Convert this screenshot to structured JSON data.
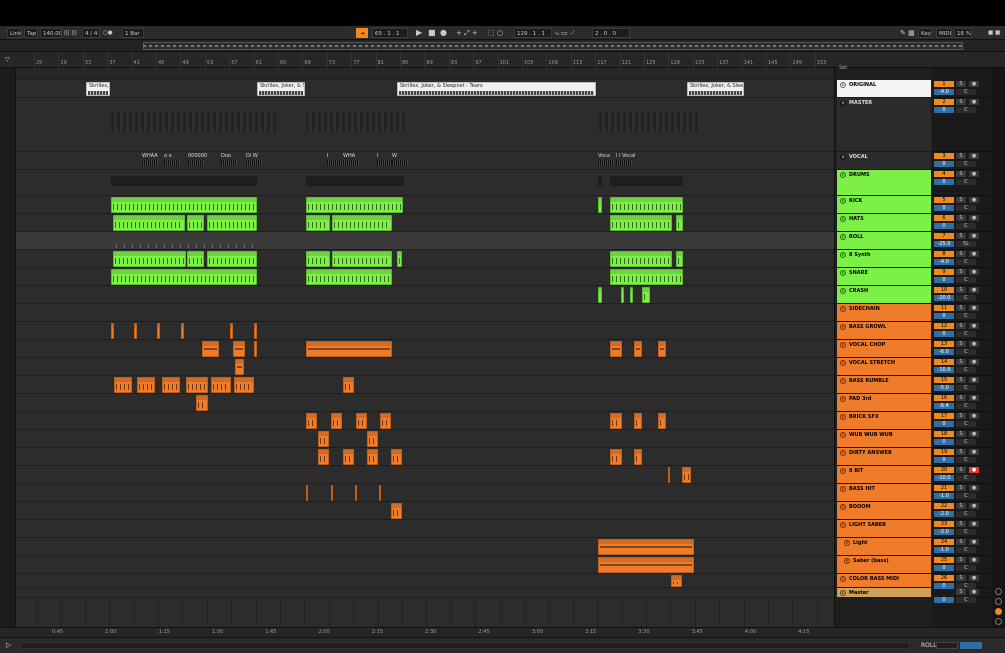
{
  "transport": {
    "link": "Link",
    "tap": "Tap",
    "tempo": "140.00",
    "sig": "4 / 4",
    "quantize": "1 Bar",
    "position": "65 .  1 .  1",
    "loop_start": "129 .  1 .  1",
    "loop_length": "2 .  0 .  0",
    "key": "Key",
    "midi": "MIDI",
    "cpu": "16 %",
    "set": "Set"
  },
  "bar_numbers": [
    "25",
    "29",
    "33",
    "37",
    "41",
    "45",
    "49",
    "53",
    "57",
    "61",
    "65",
    "69",
    "73",
    "77",
    "81",
    "85",
    "89",
    "93",
    "97",
    "101",
    "105",
    "109",
    "113",
    "117",
    "121",
    "125",
    "129",
    "133",
    "137",
    "141",
    "145",
    "149",
    "153"
  ],
  "time_markers": [
    "0:45",
    "1:00",
    "1:15",
    "1:30",
    "1:45",
    "2:00",
    "2:15",
    "2:30",
    "2:45",
    "3:00",
    "3:15",
    "3:30",
    "3:45",
    "4:00",
    "4:15"
  ],
  "reference_clips": [
    "Skrillex, J",
    "Skrillex, Joker, & Sle",
    "Skrillex, Joker, & Sleepnet - Tears",
    "Skrillex, Joker, & Sleep"
  ],
  "vocal_labels": [
    "WHAA",
    "o o",
    "000000",
    "Doo",
    "Di W",
    "I",
    "WHA",
    "I",
    "W",
    "Voca",
    "I I Vocal"
  ],
  "tracks": [
    {
      "name": "ORIGINAL",
      "num": "1",
      "vol": "-4.0",
      "pan": "C",
      "color": "white"
    },
    {
      "name": "MASTER",
      "num": "2",
      "vol": "0",
      "pan": "C",
      "color": "dark"
    },
    {
      "name": "VOCAL",
      "num": "3",
      "vol": "0",
      "pan": "C",
      "color": "dark"
    },
    {
      "name": "DRUMS",
      "num": "4",
      "vol": "0",
      "pan": "C",
      "color": "green"
    },
    {
      "name": "KICK",
      "num": "5",
      "vol": "0",
      "pan": "C",
      "color": "green"
    },
    {
      "name": "HATS",
      "num": "6",
      "vol": "0",
      "pan": "C",
      "color": "green"
    },
    {
      "name": "ROLL",
      "num": "7",
      "vol": "-25.0",
      "pan": "5L",
      "color": "green"
    },
    {
      "name": "8 Synth",
      "num": "8",
      "vol": "-4.0",
      "pan": "C",
      "color": "green"
    },
    {
      "name": "SNARE",
      "num": "9",
      "vol": "0",
      "pan": "C",
      "color": "green"
    },
    {
      "name": "CRASH",
      "num": "10",
      "vol": "-20.0",
      "pan": "C",
      "color": "green"
    },
    {
      "name": "SIDECHAIN",
      "num": "11",
      "vol": "0",
      "pan": "C",
      "color": "orange"
    },
    {
      "name": "BASS GROWL",
      "num": "12",
      "vol": "0",
      "pan": "C",
      "color": "orange"
    },
    {
      "name": "VOCAL CHOP",
      "num": "13",
      "vol": "-6.0",
      "pan": "C",
      "color": "orange"
    },
    {
      "name": "VOCAL STRETCH",
      "num": "14",
      "vol": "-10.9",
      "pan": "C",
      "color": "orange"
    },
    {
      "name": "BASS RUMBLE",
      "num": "15",
      "vol": "-5.0",
      "pan": "C",
      "color": "orange"
    },
    {
      "name": "PAD 3rd",
      "num": "16",
      "vol": "-6.4",
      "pan": "C",
      "color": "orange"
    },
    {
      "name": "BRICK SFX",
      "num": "17",
      "vol": "0",
      "pan": "C",
      "color": "orange"
    },
    {
      "name": "WUB WUB WUB",
      "num": "18",
      "vol": "0",
      "pan": "C",
      "color": "orange"
    },
    {
      "name": "DIRTY ANSWER",
      "num": "19",
      "vol": "0",
      "pan": "C",
      "color": "orange"
    },
    {
      "name": "8 BIT",
      "num": "20",
      "vol": "-10.0",
      "pan": "C",
      "color": "orange",
      "armed": true
    },
    {
      "name": "BASS HIT",
      "num": "21",
      "vol": "-1.0",
      "pan": "C",
      "color": "orange"
    },
    {
      "name": "BOOOM",
      "num": "22",
      "vol": "-2.0",
      "pan": "C",
      "color": "orange"
    },
    {
      "name": "LIGHT SABER",
      "num": "23",
      "vol": "-2.0",
      "pan": "C",
      "color": "orange"
    },
    {
      "name": "Light",
      "num": "24",
      "vol": "-1.0",
      "pan": "C",
      "color": "orange",
      "sub": true
    },
    {
      "name": "Saber (bass)",
      "num": "25",
      "vol": "0",
      "pan": "C",
      "color": "orange",
      "sub": true
    },
    {
      "name": "COLOR BASS MIDI",
      "num": "26",
      "vol": "0",
      "pan": "C",
      "color": "orange"
    },
    {
      "name": "Master",
      "num": "",
      "vol": "0",
      "pan": "C",
      "color": "gold"
    }
  ],
  "status": {
    "roll": "ROLL"
  },
  "colors": {
    "green": "#7cf046",
    "orange": "#ef7c2b",
    "accent": "#ee8a1e",
    "blue": "#2f6fa6"
  }
}
